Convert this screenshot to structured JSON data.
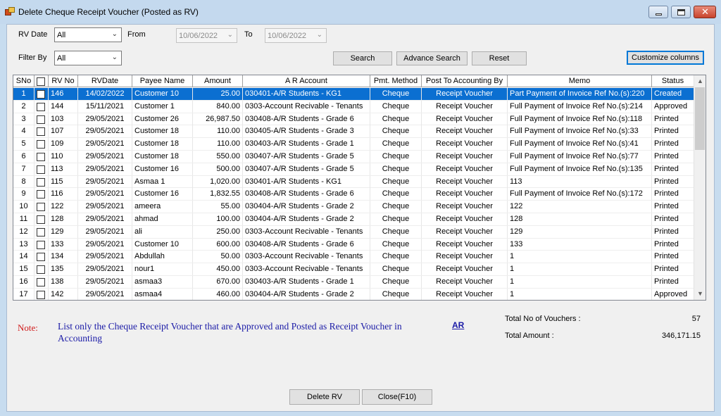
{
  "window": {
    "title": "Delete Cheque Receipt Voucher (Posted as RV)",
    "controls": {
      "minimize": "",
      "maximize": "",
      "close": "✕"
    }
  },
  "filters": {
    "rv_date_label": "RV Date",
    "rv_date_value": "All",
    "from_label": "From",
    "from_value": "10/06/2022",
    "to_label": "To",
    "to_value": "10/06/2022",
    "filter_by_label": "Filter By",
    "filter_by_value": "All"
  },
  "buttons": {
    "search": "Search",
    "advance_search": "Advance Search",
    "reset": "Reset",
    "customize_columns": "Customize columns",
    "delete_rv": "Delete RV",
    "close": "Close(F10)"
  },
  "grid": {
    "columns": [
      "SNo",
      "",
      "RV  No",
      "RVDate",
      "Payee Name",
      "Amount",
      "A R Account",
      "Pmt. Method",
      "Post To Accounting By",
      "Memo",
      "Status"
    ],
    "rows": [
      {
        "sno": "1",
        "rv_no": "146",
        "date": "14/02/2022",
        "payee": "Customer 10",
        "amount": "25.00",
        "account": "030401-A/R Students - KG1",
        "method": "Cheque",
        "post": "Receipt Voucher",
        "memo": "Part Payment of Invoice Ref No.(s):220",
        "status": "Created"
      },
      {
        "sno": "2",
        "rv_no": "144",
        "date": "15/11/2021",
        "payee": "Customer 1",
        "amount": "840.00",
        "account": "0303-Account Recivable - Tenants",
        "method": "Cheque",
        "post": "Receipt Voucher",
        "memo": "Full Payment of Invoice Ref No.(s):214",
        "status": "Approved"
      },
      {
        "sno": "3",
        "rv_no": "103",
        "date": "29/05/2021",
        "payee": "Customer 26",
        "amount": "26,987.50",
        "account": "030408-A/R Students - Grade 6",
        "method": "Cheque",
        "post": "Receipt Voucher",
        "memo": "Full Payment of Invoice Ref No.(s):118",
        "status": "Printed"
      },
      {
        "sno": "4",
        "rv_no": "107",
        "date": "29/05/2021",
        "payee": "Customer 18",
        "amount": "110.00",
        "account": "030405-A/R Students - Grade 3",
        "method": "Cheque",
        "post": "Receipt Voucher",
        "memo": "Full Payment of Invoice Ref No.(s):33",
        "status": "Printed"
      },
      {
        "sno": "5",
        "rv_no": "109",
        "date": "29/05/2021",
        "payee": "Customer 18",
        "amount": "110.00",
        "account": "030403-A/R Students - Grade 1",
        "method": "Cheque",
        "post": "Receipt Voucher",
        "memo": "Full Payment of Invoice Ref No.(s):41",
        "status": "Printed"
      },
      {
        "sno": "6",
        "rv_no": "110",
        "date": "29/05/2021",
        "payee": "Customer 18",
        "amount": "550.00",
        "account": "030407-A/R Students - Grade 5",
        "method": "Cheque",
        "post": "Receipt Voucher",
        "memo": "Full Payment of Invoice Ref No.(s):77",
        "status": "Printed"
      },
      {
        "sno": "7",
        "rv_no": "113",
        "date": "29/05/2021",
        "payee": "Customer 16",
        "amount": "500.00",
        "account": "030407-A/R Students - Grade 5",
        "method": "Cheque",
        "post": "Receipt Voucher",
        "memo": "Full Payment of Invoice Ref No.(s):135",
        "status": "Printed"
      },
      {
        "sno": "8",
        "rv_no": "115",
        "date": "29/05/2021",
        "payee": "Asmaa 1",
        "amount": "1,020.00",
        "account": "030401-A/R Students - KG1",
        "method": "Cheque",
        "post": "Receipt Voucher",
        "memo": "113",
        "status": "Printed"
      },
      {
        "sno": "9",
        "rv_no": "116",
        "date": "29/05/2021",
        "payee": "Customer 16",
        "amount": "1,832.55",
        "account": "030408-A/R Students - Grade 6",
        "method": "Cheque",
        "post": "Receipt Voucher",
        "memo": "Full Payment of Invoice Ref No.(s):172",
        "status": "Printed"
      },
      {
        "sno": "10",
        "rv_no": "122",
        "date": "29/05/2021",
        "payee": "ameera",
        "amount": "55.00",
        "account": "030404-A/R Students - Grade 2",
        "method": "Cheque",
        "post": "Receipt Voucher",
        "memo": "122",
        "status": "Printed"
      },
      {
        "sno": "11",
        "rv_no": "128",
        "date": "29/05/2021",
        "payee": "ahmad",
        "amount": "100.00",
        "account": "030404-A/R Students - Grade 2",
        "method": "Cheque",
        "post": "Receipt Voucher",
        "memo": "128",
        "status": "Printed"
      },
      {
        "sno": "12",
        "rv_no": "129",
        "date": "29/05/2021",
        "payee": "ali",
        "amount": "250.00",
        "account": "0303-Account Recivable - Tenants",
        "method": "Cheque",
        "post": "Receipt Voucher",
        "memo": "129",
        "status": "Printed"
      },
      {
        "sno": "13",
        "rv_no": "133",
        "date": "29/05/2021",
        "payee": "Customer 10",
        "amount": "600.00",
        "account": "030408-A/R Students - Grade 6",
        "method": "Cheque",
        "post": "Receipt Voucher",
        "memo": "133",
        "status": "Printed"
      },
      {
        "sno": "14",
        "rv_no": "134",
        "date": "29/05/2021",
        "payee": "Abdullah",
        "amount": "50.00",
        "account": "0303-Account Recivable - Tenants",
        "method": "Cheque",
        "post": "Receipt Voucher",
        "memo": "1",
        "status": "Printed"
      },
      {
        "sno": "15",
        "rv_no": "135",
        "date": "29/05/2021",
        "payee": "nour1",
        "amount": "450.00",
        "account": "0303-Account Recivable - Tenants",
        "method": "Cheque",
        "post": "Receipt Voucher",
        "memo": "1",
        "status": "Printed"
      },
      {
        "sno": "16",
        "rv_no": "138",
        "date": "29/05/2021",
        "payee": "asmaa3",
        "amount": "670.00",
        "account": "030403-A/R Students - Grade 1",
        "method": "Cheque",
        "post": "Receipt Voucher",
        "memo": "1",
        "status": "Printed"
      },
      {
        "sno": "17",
        "rv_no": "142",
        "date": "29/05/2021",
        "payee": "asmaa4",
        "amount": "460.00",
        "account": "030404-A/R Students - Grade 2",
        "method": "Cheque",
        "post": "Receipt Voucher",
        "memo": "1",
        "status": "Approved"
      }
    ],
    "selected_row": "1",
    "scroll_up": "▲",
    "scroll_down": "▼"
  },
  "note": {
    "label": "Note:",
    "text": "List only the Cheque Receipt Voucher that are Approved and Posted as Receipt Voucher in Accounting",
    "link": "AR"
  },
  "totals": {
    "vouchers_label": "Total No of Vouchers :",
    "vouchers_value": "57",
    "amount_label": "Total Amount :",
    "amount_value": "346,171.15"
  },
  "colors": {
    "selection": "#0b6fd1",
    "note_label": "#d01a1a",
    "note_text": "#1a1aa6"
  }
}
